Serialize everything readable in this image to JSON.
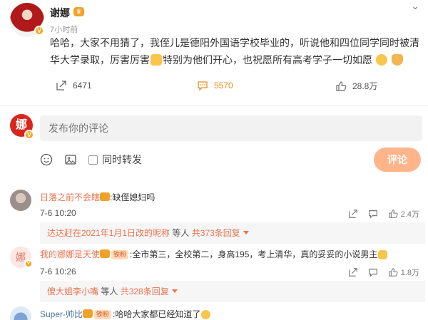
{
  "post": {
    "author": "谢娜",
    "time": "7小时前",
    "content_a": "哈哈，大家不用猜了，我侄儿是德阳外国语学校毕业的，听说他和四位同学同时被清华大学录取，厉害厉害",
    "content_b": "特别为他们开心，也祝愿所有高考学子一切如愿",
    "repost_count": "6471",
    "comment_count": "5570",
    "like_count": "28.8万"
  },
  "composer": {
    "placeholder": "发布你的评论",
    "repost_label": "同时转发",
    "submit_label": "评论"
  },
  "comments": [
    {
      "name": "日落之前不会瞎",
      "text": ":缺侄媳妇吗",
      "time": "7-6 10:20",
      "like_count": "2.4万",
      "replies": {
        "replier": "达达赶在2021年1月1日改的昵称",
        "mid": " 等人 ",
        "count": "共373条回复"
      }
    },
    {
      "name": "我的娜娜是天使",
      "badge": "铁粉",
      "text": ":全市第三，全校第二，身高195，考上清华，真的妥妥的小说男主",
      "time": "7-6 10:26",
      "like_count": "1.8万",
      "replies": {
        "replier": "傻大姐李小嘴",
        "mid": " 等人 ",
        "count": "共328条回复"
      }
    },
    {
      "name": "Super-帅比",
      "badge": "铁粉",
      "text": ":哈哈大家都已经知道了"
    }
  ],
  "colors": {
    "accent_orange": "#f08b1e",
    "comment_button": "#ffb48a",
    "link_name": "#eb7350"
  }
}
